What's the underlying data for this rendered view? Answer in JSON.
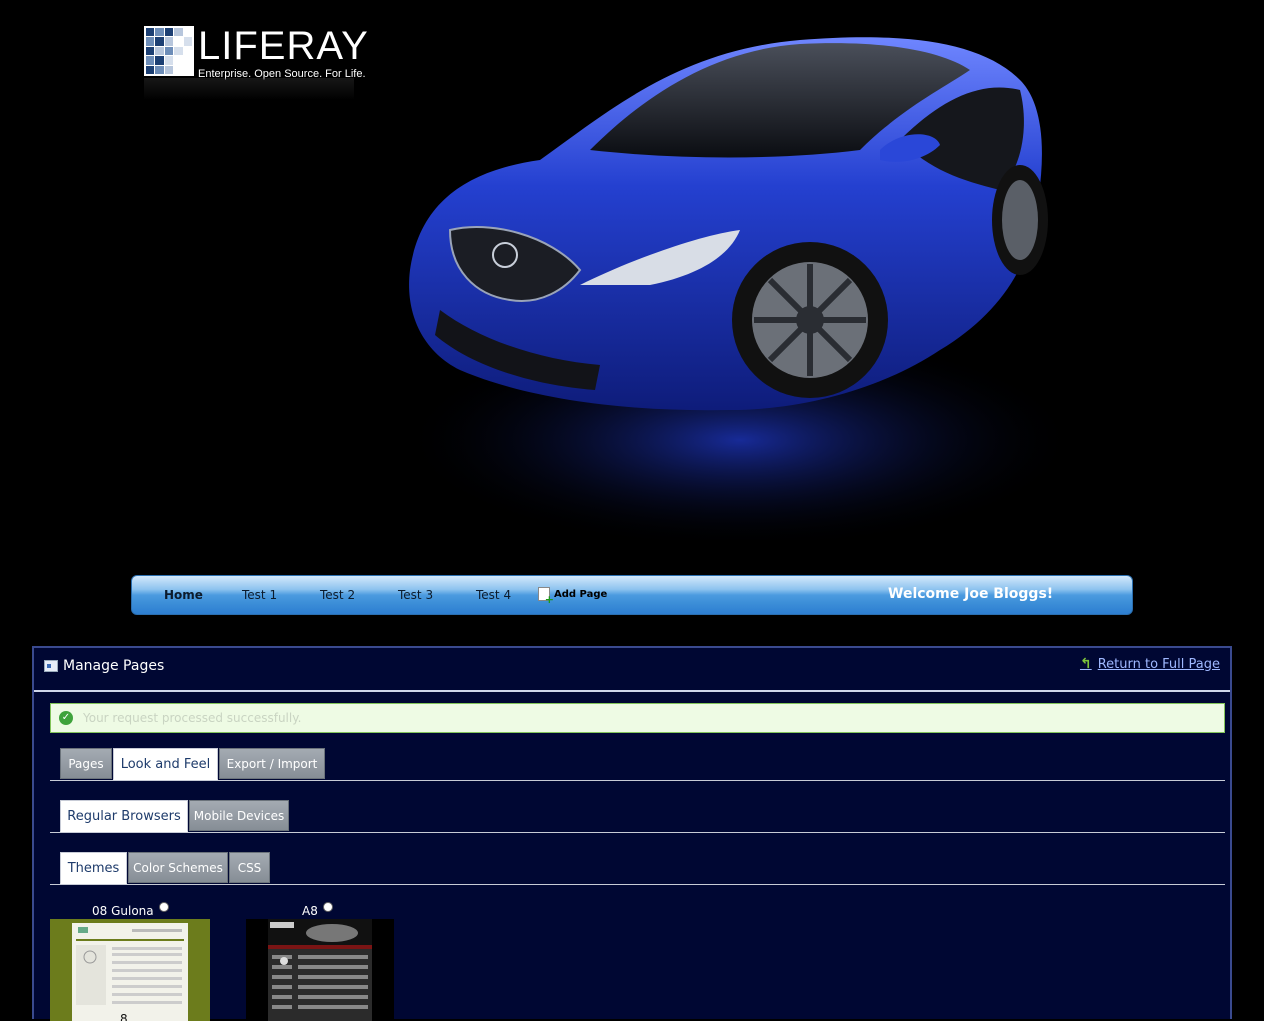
{
  "header": {
    "logo_text": "LIFERAY",
    "logo_tagline": "Enterprise. Open Source. For Life."
  },
  "nav": {
    "items": [
      {
        "label": "Home",
        "active": true
      },
      {
        "label": "Test 1",
        "active": false
      },
      {
        "label": "Test 2",
        "active": false
      },
      {
        "label": "Test 3",
        "active": false
      },
      {
        "label": "Test 4",
        "active": false
      }
    ],
    "add_page_label": "Add Page",
    "welcome": "Welcome Joe Bloggs!"
  },
  "panel": {
    "title": "Manage Pages",
    "return_link": "Return to Full Page",
    "success_message": "Your request processed successfully.",
    "tabs": [
      {
        "label": "Pages",
        "selected": false
      },
      {
        "label": "Look and Feel",
        "selected": true
      },
      {
        "label": "Export / Import",
        "selected": false
      }
    ],
    "device_tabs": [
      {
        "label": "Regular Browsers",
        "selected": true
      },
      {
        "label": "Mobile Devices",
        "selected": false
      }
    ],
    "theme_tabs": [
      {
        "label": "Themes",
        "selected": true
      },
      {
        "label": "Color Schemes",
        "selected": false
      },
      {
        "label": "CSS",
        "selected": false
      }
    ],
    "themes": [
      {
        "name": "08 Gulona"
      },
      {
        "name": "A8"
      }
    ]
  },
  "colors": {
    "page_bg": "#000000",
    "panel_bg": "#000733",
    "nav_blue": "#3d8fd8",
    "car_blue": "#1f3fbf",
    "success_green": "#3fa33c"
  }
}
